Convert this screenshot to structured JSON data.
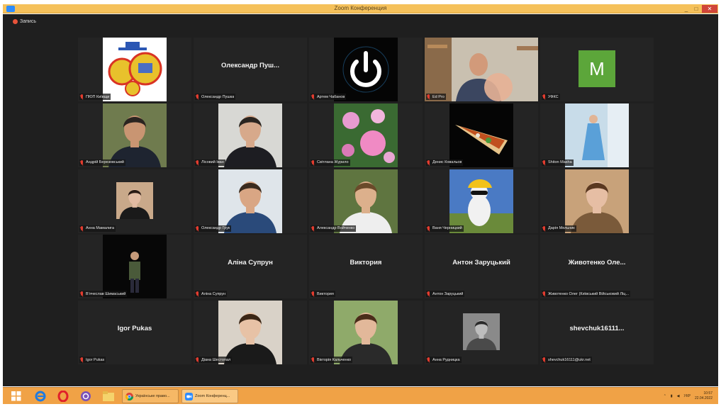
{
  "window": {
    "title": "Zoom Конференция",
    "minimize": "_",
    "maximize": "□",
    "close": "✕"
  },
  "recording": {
    "label": "Запись"
  },
  "participants": [
    {
      "label": "ПЮП Київщи",
      "kind": "logo"
    },
    {
      "label": "Олександр Пушка",
      "name_display": "Олександр  Пуш..."
    },
    {
      "label": "Артем Чабанов",
      "kind": "power"
    },
    {
      "label": "Ed Pro",
      "kind": "cam",
      "active": true
    },
    {
      "label": "УФКС",
      "kind": "letter",
      "letter": "M",
      "letter_color": "#5ca63a"
    },
    {
      "label": "Андрій Березовський",
      "kind": "person",
      "bg": "#6f7b4e",
      "skin": "#c99572",
      "hair": "#2a2420",
      "shirt": "#1e2430"
    },
    {
      "label": "Лісовий Іван",
      "kind": "person",
      "bg": "#d8d8d4",
      "skin": "#d7a98b",
      "hair": "#2b2520",
      "shirt": "#1d1d22"
    },
    {
      "label": "Світлана Журило",
      "kind": "flowers"
    },
    {
      "label": "Денис Ковальов",
      "kind": "shawarma"
    },
    {
      "label": "Shiton Masha",
      "kind": "dress"
    },
    {
      "label": "Анна Мамалига",
      "kind": "person",
      "small": true,
      "bg": "#c9a98a",
      "skin": "#e2bba2",
      "hair": "#2a1a14",
      "shirt": "#1a1a1a"
    },
    {
      "label": "Олександр Грук",
      "kind": "person",
      "bg": "#dfe5ea",
      "skin": "#d9a684",
      "hair": "#3a2a1e",
      "shirt": "#2a4a7a"
    },
    {
      "label": "Александр Войченко",
      "kind": "person",
      "bg": "#5f7540",
      "skin": "#dcb08c",
      "hair": "#6a4a2a",
      "shirt": "#eeeeee"
    },
    {
      "label": "Ваня Черницкий",
      "kind": "cat"
    },
    {
      "label": "Дарія Мельник",
      "kind": "person",
      "bg": "#c8a27a",
      "skin": "#e6bea4",
      "hair": "#5a3820",
      "shirt": "#7a5a3a"
    },
    {
      "label": "Вʼячеслав Шимаський",
      "kind": "night"
    },
    {
      "label": "Аліна Супрун",
      "name_display": "Аліна Супрун"
    },
    {
      "label": "Виктория",
      "name_display": "Виктория"
    },
    {
      "label": "Антон Заруцький",
      "name_display": "Антон Заруцький"
    },
    {
      "label": "Животенко Олег (Київський Військовий Ліц...",
      "name_display": "Животенко  Оле..."
    },
    {
      "label": "Igor Pukas",
      "name_display": "Igor Pukas"
    },
    {
      "label": "Діана Шестопал",
      "kind": "person",
      "bg": "#d9d2c8",
      "skin": "#e7c2a6",
      "hair": "#3a2616",
      "shirt": "#1a1a1a"
    },
    {
      "label": "Вікторія Кальченко",
      "kind": "person",
      "bg": "#8faa6a",
      "skin": "#e2b89a",
      "hair": "#4a2c1a",
      "shirt": "#2a2a2a"
    },
    {
      "label": "Анна Рудницка",
      "kind": "person",
      "small": true,
      "bg": "#8a8a8a",
      "skin": "#bdbdbd",
      "hair": "#2a2a2a",
      "shirt": "#4a4a4a"
    },
    {
      "label": "shevchuk16111@ukr.net",
      "name_display": "shevchuk16111..."
    }
  ],
  "taskbar": {
    "tasks": [
      {
        "label": "Українське право..."
      },
      {
        "label": "Zoom Конференц..."
      }
    ],
    "language": "УКР",
    "time": "10:57",
    "date": "22.04.2022"
  }
}
